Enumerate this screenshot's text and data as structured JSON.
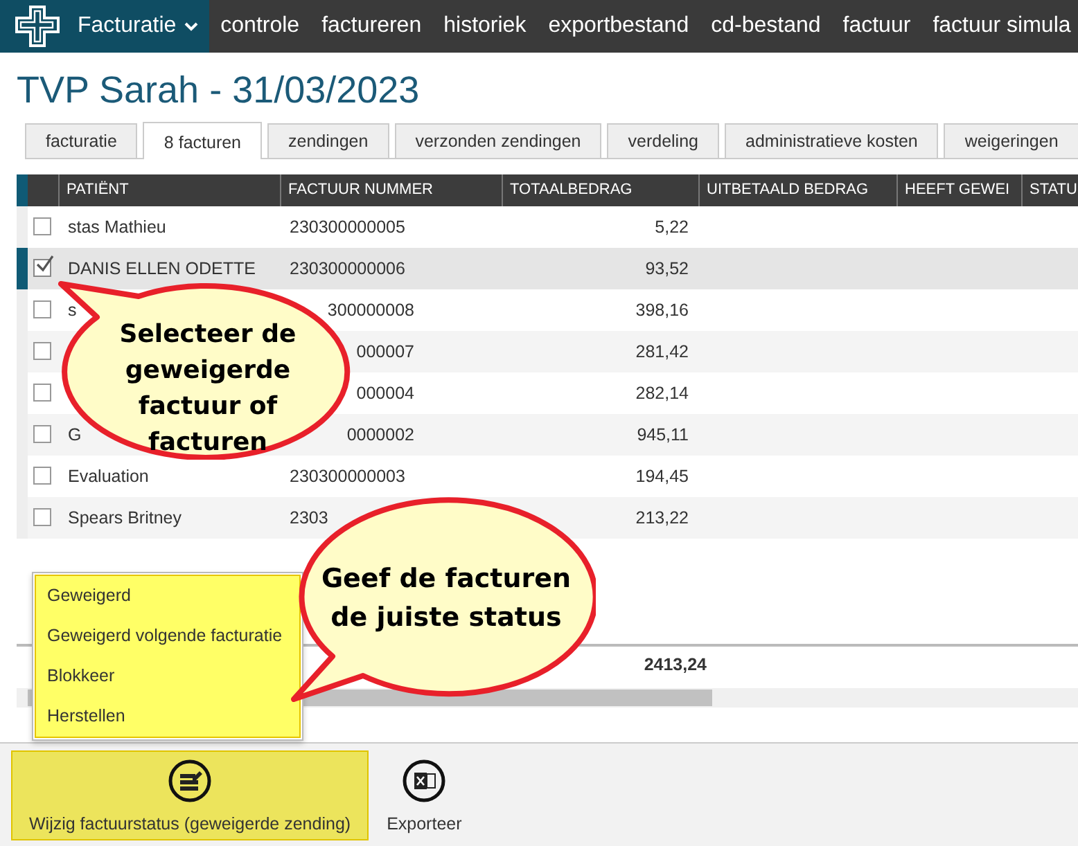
{
  "nav": {
    "app_menu": "Facturatie",
    "items": [
      "controle",
      "factureren",
      "historiek",
      "exportbestand",
      "cd-bestand",
      "factuur",
      "factuur simula"
    ]
  },
  "title": "TVP Sarah - 31/03/2023",
  "tabs": [
    {
      "label": "facturatie",
      "selected": false
    },
    {
      "label": "8 facturen",
      "selected": true
    },
    {
      "label": "zendingen",
      "selected": false
    },
    {
      "label": "verzonden zendingen",
      "selected": false
    },
    {
      "label": "verdeling",
      "selected": false
    },
    {
      "label": "administratieve kosten",
      "selected": false
    },
    {
      "label": "weigeringen",
      "selected": false
    }
  ],
  "table": {
    "columns": [
      "PATIËNT",
      "FACTUUR NUMMER",
      "TOTAALBEDRAG",
      "UITBETAALD BEDRAG",
      "HEEFT GEWEI",
      "STATU"
    ],
    "rows": [
      {
        "checked": false,
        "selected": false,
        "patient": "stas Mathieu",
        "number": "230300000005",
        "cut": false,
        "total": "5,22"
      },
      {
        "checked": true,
        "selected": true,
        "patient": "DANIS ELLEN ODETTE",
        "number": "230300000006",
        "cut": false,
        "total": "93,52"
      },
      {
        "checked": false,
        "selected": false,
        "patient": "s",
        "number": "300000008",
        "cut": true,
        "total": "398,16"
      },
      {
        "checked": false,
        "selected": false,
        "number": "000007",
        "cut": true,
        "total": "281,42"
      },
      {
        "checked": false,
        "selected": false,
        "number": "000004",
        "cut": true,
        "total": "282,14"
      },
      {
        "checked": false,
        "selected": false,
        "patient": "G",
        "number": "0000002",
        "cut": true,
        "total": "945,11"
      },
      {
        "checked": false,
        "selected": false,
        "patient": "Evaluation",
        "number": "230300000003",
        "cut": false,
        "total": "194,45"
      },
      {
        "checked": false,
        "selected": false,
        "patient": "Spears Britney",
        "number": "2303",
        "cut": false,
        "total": "213,22"
      }
    ],
    "footer_total": "2413,24"
  },
  "menu": {
    "highlighted": true,
    "items": [
      "Geweigerd",
      "Geweigerd volgende facturatie",
      "Blokkeer",
      "Herstellen"
    ]
  },
  "toolbar": [
    {
      "label": "Wijzig factuurstatus (geweigerde zending)",
      "kind": "edit",
      "highlighted": true
    },
    {
      "label": "Exporteer",
      "kind": "excel",
      "highlighted": false
    }
  ],
  "callouts": [
    "Selecteer de geweigerde factuur of facturen",
    "Geef de facturen de juiste status"
  ]
}
